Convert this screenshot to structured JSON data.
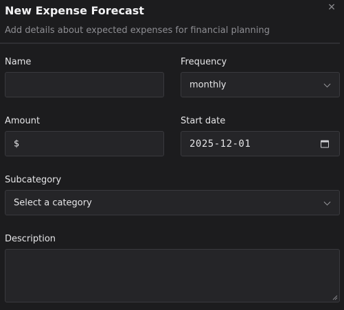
{
  "dialog": {
    "title": "New Expense Forecast",
    "subtitle": "Add details about expected expenses for financial planning"
  },
  "form": {
    "name": {
      "label": "Name",
      "value": ""
    },
    "frequency": {
      "label": "Frequency",
      "value": "monthly"
    },
    "amount": {
      "label": "Amount",
      "prefix": "$",
      "value": ""
    },
    "start_date": {
      "label": "Start date",
      "value": "2025-12-01"
    },
    "subcategory": {
      "label": "Subcategory",
      "value": "Select a category"
    },
    "description": {
      "label": "Description",
      "value": ""
    }
  },
  "icons": {
    "close": "close-icon",
    "chevron": "chevron-down-icon",
    "calendar": "calendar-icon"
  }
}
